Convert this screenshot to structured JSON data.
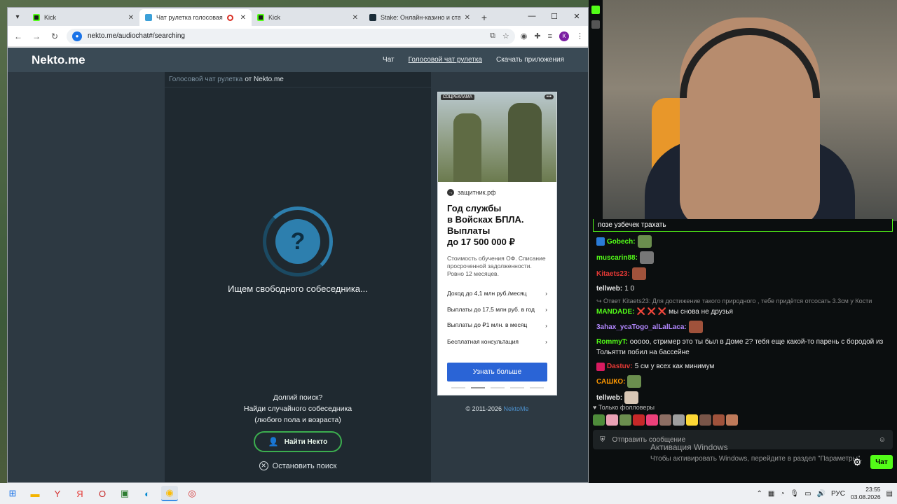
{
  "browser": {
    "tabs": [
      {
        "title": "Kick",
        "favicon": "kick",
        "active": false
      },
      {
        "title": "Чат рулетка голосовая — ",
        "favicon": "nekto",
        "active": true,
        "recording": true
      },
      {
        "title": "Kick",
        "favicon": "kick",
        "active": false
      },
      {
        "title": "Stake: Онлайн-казино и ставк",
        "favicon": "stake",
        "active": false
      }
    ],
    "url": "nekto.me/audiochat#/searching"
  },
  "site": {
    "logo": "Nekto.me",
    "nav": [
      "Чат",
      "Голосовой чат рулетка",
      "Скачать приложения"
    ],
    "breadcrumb_link": "Голосовой чат рулетка",
    "breadcrumb_rest": "от Nekto.me",
    "spinner_char": "?",
    "searching_text": "Ищем свободного собеседника...",
    "hint_lines": [
      "Долгий поиск?",
      "Найди случайного собеседника",
      "(любого пола и возраста)"
    ],
    "find_button": "Найти Некто",
    "stop_search": "Остановить поиск",
    "copyright_prefix": "© 2011-2026",
    "copyright_link": "NektoMe"
  },
  "ad": {
    "label": "СОЦРЕКЛАМА",
    "more": "•••",
    "domain": "защитник.рф",
    "title_lines": [
      "Год службы",
      "в Войсках БПЛА.",
      "Выплаты",
      "до 17 500 000 ₽"
    ],
    "description": "Стоимость обучения ОФ. Списание просроченной задолженности. Ровно 12 месяцев.",
    "items": [
      "Доход до 4,1 млн руб./месяц",
      "Выплаты до 17,5 млн руб. в год",
      "Выплаты до ₽1 млн. в месяц",
      "Бесплатная консультация"
    ],
    "cta": "Узнать больше"
  },
  "chat": {
    "pinned": "позе узбечек трахать",
    "messages": [
      {
        "user": "Gobech:",
        "color": "#53fc18",
        "text": "",
        "emote": true
      },
      {
        "user": "muscarin88:",
        "color": "#53fc18",
        "text": "",
        "emote": true
      },
      {
        "user": "Kitaets23:",
        "color": "#e53935",
        "text": "",
        "emote": true
      },
      {
        "user": "tellweb:",
        "color": "#e8e8e8",
        "text": "1 0",
        "emote": false
      },
      {
        "reply": "↪ Ответ Kitaets23: Для достижение такого природного , тебе придётся отсосать 3.3см у Кости",
        "user": "MANDADE:",
        "color": "#53fc18",
        "text": "❌ ❌ ❌ мы снова не друзья",
        "emote": false
      },
      {
        "user": "3ahax_ycaTogo_alLalLaca:",
        "color": "#b388ff",
        "text": "",
        "emote": true
      },
      {
        "user": "RommyT:",
        "color": "#53fc18",
        "text": "ооооо, стример это ты был в Доме 2? тебя еще какой-то парень с бородой из Тольятти побил на бассейне",
        "emote": false
      },
      {
        "user": "Dastuv:",
        "color": "#e53935",
        "text": "5 см у всех как минимум",
        "emote": false
      },
      {
        "user": "САШКО:",
        "color": "#ff9800",
        "text": "",
        "emote": true
      },
      {
        "user": "tellweb:",
        "color": "#e8e8e8",
        "text": "",
        "emote": true
      }
    ],
    "followers_only": "♥ Только фолловеры",
    "input_placeholder": "Отправить сообщение",
    "send_label": "Чат"
  },
  "windows": {
    "activation_title": "Активация Windows",
    "activation_text": "Чтобы активировать Windows, перейдите в раздел \"Параметры\".",
    "lang": "РУС",
    "time": "23:55",
    "date": "03.08.2026"
  },
  "colors": {
    "accent_green": "#53fc18",
    "nekto_blue": "#2d7fae",
    "ad_cta": "#2a64d6"
  }
}
